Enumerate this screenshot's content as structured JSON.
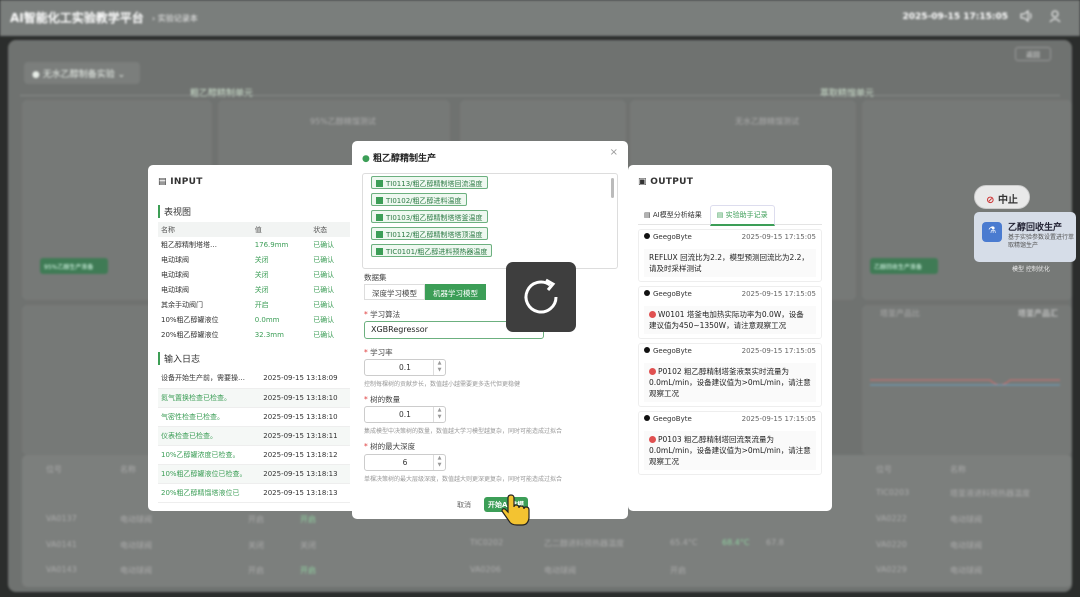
{
  "header": {
    "app_title": "AI智能化工实验教学平台",
    "breadcrumb": "实验记录本",
    "datetime": "2025-09-15 17:15:05",
    "icons": [
      "speaker-icon",
      "user-icon"
    ]
  },
  "background": {
    "experiment_selector": "无水乙醇制备实验",
    "return_btn": "返回",
    "section_left": "粗乙醇精制单元",
    "section_right": "萃取精馏单元",
    "left_panel_label": "95%乙醇精馏测试",
    "right_panel_label": "无水乙醇精馏测试",
    "ok_chip_left": "95%乙醇生产准备",
    "ok_chip_right": "乙醇回收生产准备",
    "stop_btn": "中止",
    "recover_title": "乙醇回收生产",
    "recover_sub": "基于实验参数设置进行萃取精馏生产",
    "recover_meta": "模型 控制优化",
    "bottom_left_rows": [
      [
        "VA0137",
        "电动球阀",
        "开启",
        "开启"
      ],
      [
        "VA0141",
        "电动球阀",
        "关闭",
        "关闭"
      ],
      [
        "VA0143",
        "电动球阀",
        "开启",
        "开启"
      ]
    ],
    "bottom_mid_rows": [
      [
        "TIC0202",
        "乙二醇进料预热器温度",
        "65.4°C",
        "68.4°C",
        "67.8"
      ],
      [
        "VA0206",
        "电动球阀",
        "开启",
        "",
        ""
      ]
    ],
    "bottom_right_rows": [
      [
        "位号",
        "名称"
      ],
      [
        "TIC0203",
        "塔釜液进料预热器温度"
      ],
      [
        "VA0222",
        "电动球阀"
      ],
      [
        "VA0220",
        "电动球阀"
      ],
      [
        "VA0229",
        "电动球阀"
      ]
    ],
    "chart_label_right": "塔釜产品比",
    "chart_label_right2": "塔釜产品汇"
  },
  "input": {
    "title": "INPUT",
    "table_title": "表视图",
    "columns": [
      "名称",
      "值",
      "状态"
    ],
    "rows": [
      [
        "粗乙醇精制塔塔…",
        "176.9mm",
        "已确认"
      ],
      [
        "电动球阀",
        "关闭",
        "已确认"
      ],
      [
        "电动球阀",
        "关闭",
        "已确认"
      ],
      [
        "电动球阀",
        "关闭",
        "已确认"
      ],
      [
        "其余手动阀门",
        "开启",
        "已确认"
      ],
      [
        "10%粗乙醇罐液位",
        "0.0mm",
        "已确认"
      ],
      [
        "20%粗乙醇罐液位",
        "32.3mm",
        "已确认"
      ]
    ],
    "log_title": "输入日志",
    "logs": [
      [
        "设备开始生产前，需要操…",
        "2025-09-15 13:18:09"
      ],
      [
        "氮气置换检查已检查。",
        "2025-09-15 13:18:10"
      ],
      [
        "气密性检查已检查。",
        "2025-09-15 13:18:10"
      ],
      [
        "仪表检查已检查。",
        "2025-09-15 13:18:11"
      ],
      [
        "10%乙醇罐浓度已检查。",
        "2025-09-15 13:18:12"
      ],
      [
        "10%粗乙醇罐液位已检查。",
        "2025-09-15 13:18:13"
      ],
      [
        "20%粗乙醇精馏塔液位已",
        "2025-09-15 13:18:13"
      ]
    ]
  },
  "modal": {
    "title": "粗乙醇精制生产",
    "tags": [
      "TI0113/粗乙醇精制塔回流温度",
      "TI0102/粗乙醇进料温度",
      "TI0103/粗乙醇精制塔塔釜温度",
      "TI0112/粗乙醇精制塔塔顶温度",
      "TIC0101/粗乙醇进料预热器温度"
    ],
    "dataset_label": "数据集",
    "dataset_options": [
      "深度学习模型",
      "机器学习模型"
    ],
    "dataset_selected": "机器学习模型",
    "algo_label": "学习算法",
    "algo_value": "XGBRegressor",
    "lr_label": "学习率",
    "lr_value": "0.1",
    "lr_hint": "控制每棵树的贡献步长，数值越小越需要更多迭代但更稳健",
    "trees_label": "树的数量",
    "trees_value": "0.1",
    "trees_hint": "集成模型中决策树的数量，数值越大学习模型越复杂，同时可能造成过拟合",
    "depth_label": "树的最大深度",
    "depth_value": "6",
    "depth_hint": "单棵决策树的最大层级深度，数值越大则更深更复杂，同时可能造成过拟合",
    "cancel_btn": "取消",
    "start_btn": "开始AI建模"
  },
  "output": {
    "title": "OUTPUT",
    "tabs": [
      "AI模型分析结果",
      "实验助手记录"
    ],
    "active_tab": "实验助手记录",
    "messages": [
      {
        "sender": "GeegoByte",
        "time": "2025-09-15 17:15:05",
        "text": "REFLUX 回流比为2.2，模型预测回流比为2.2，请及时采样测试",
        "warn": false
      },
      {
        "sender": "GeegoByte",
        "time": "2025-09-15 17:15:05",
        "text": "W0101 塔釜电加热实际功率为0.0W，设备建议值为450~1350W，请注意观察工况",
        "warn": true
      },
      {
        "sender": "GeegoByte",
        "time": "2025-09-15 17:15:05",
        "text": "P0102 粗乙醇精制塔釜液泵实时流量为0.0mL/min，设备建议值为>0mL/min，请注意观察工况",
        "warn": true
      },
      {
        "sender": "GeegoByte",
        "time": "2025-09-15 17:15:05",
        "text": "P0103 粗乙醇精制塔回流泵流量为0.0mL/min，设备建议值为>0mL/min，请注意观察工况",
        "warn": true
      }
    ]
  },
  "colors": {
    "accent": "#3c9e57",
    "warn": "#e05050",
    "overlay": "#2b2d2c"
  }
}
